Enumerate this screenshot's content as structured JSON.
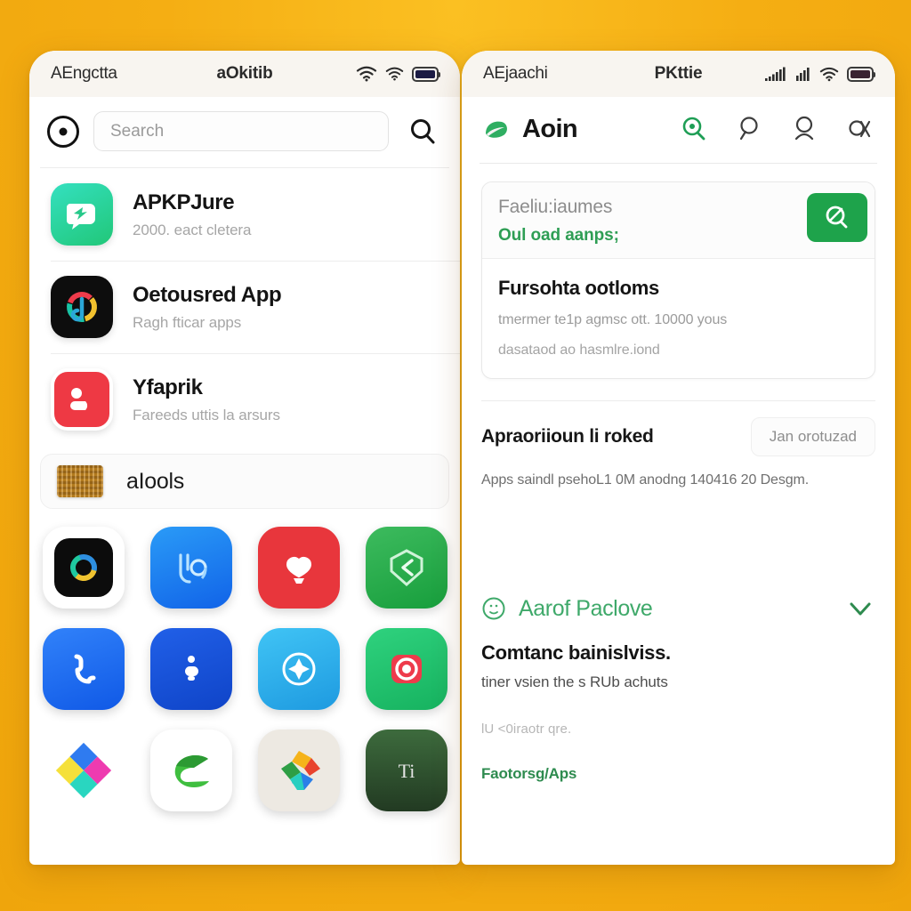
{
  "theme": {
    "background": "#F5AE13",
    "panel": "#FFFFFF",
    "statusbar": "#F8F5F0",
    "brand_green": "#1EA34B",
    "link_green": "#2E8B4F",
    "muted_text": "#A6A6A6"
  },
  "left_phone": {
    "statusbar": {
      "time": "AEngctta",
      "carrier": "aOkitib",
      "icons": [
        "wifi-icon",
        "wifi-icon",
        "battery-icon"
      ]
    },
    "search": {
      "logo_icon": "target-logo-icon",
      "placeholder": "Search",
      "submit_icon": "search-icon"
    },
    "apps": [
      {
        "name": "APKPJure",
        "subtitle": "2000. eact cletera",
        "icon": "apkpure-icon",
        "icon_color": "#2FD4A8"
      },
      {
        "name": "Oetousred App",
        "subtitle": "Ragh fticar apps",
        "icon": "discovered-app-icon",
        "icon_color": "#141414"
      },
      {
        "name": "Yfaprik",
        "subtitle": "Fareeds uttis la arsurs",
        "icon": "yfaprik-icon",
        "icon_color": "#EE3944"
      }
    ],
    "featured_row": {
      "name": "aIools",
      "icon": "gold-chip-icon"
    },
    "icon_grid": [
      {
        "name": "ring-app-icon",
        "bg": "#FFFFFF",
        "glyph": "ring"
      },
      {
        "name": "bo-app-icon",
        "bg": "#1877F2",
        "glyph": "bo"
      },
      {
        "name": "heart-app-icon",
        "bg": "#E8363C",
        "glyph": "heart"
      },
      {
        "name": "shield-app-icon",
        "bg": "#27A348",
        "glyph": "shield"
      },
      {
        "name": "phone-app-icon",
        "bg": "#1A6EF5",
        "glyph": "phone"
      },
      {
        "name": "messenger-app-icon",
        "bg": "#1456E0",
        "glyph": "messenger"
      },
      {
        "name": "compass-app-icon",
        "bg": "#2BAEF0",
        "glyph": "compass"
      },
      {
        "name": "camera-app-icon",
        "bg": "#1FBF6E",
        "glyph": "camera"
      },
      {
        "name": "diamond-app-icon",
        "bg": "#FFFFFF",
        "glyph": "diamond"
      },
      {
        "name": "e-app-icon",
        "bg": "#FFFFFF",
        "glyph": "eleaf"
      },
      {
        "name": "pinwheel-app-icon",
        "bg": "#EDE9E2",
        "glyph": "pinwheel"
      },
      {
        "name": "ti-app-icon",
        "bg": "#2E4A2E",
        "glyph": "ti"
      }
    ]
  },
  "right_phone": {
    "statusbar": {
      "time": "AEjaachi",
      "carrier": "PKttie",
      "icons": [
        "signal-icon",
        "signal-icon",
        "wifi-icon",
        "battery-icon"
      ]
    },
    "header": {
      "brand_icon": "leaf-brand-icon",
      "brand_name": "Aoin",
      "actions": [
        {
          "name": "search-active-icon"
        },
        {
          "name": "search-icon"
        },
        {
          "name": "account-icon"
        },
        {
          "name": "settings-icon"
        }
      ]
    },
    "promo_card": {
      "title": "Faeliu:iaumes",
      "subtitle": "Oul oad aanps;",
      "cta_icon": "download-search-icon",
      "body_heading": "Fursohta ootloms",
      "body_line1": "tmermer te1p agmsc ott. 10000 yous",
      "body_line2": "dasataod ao hasmlre.iond"
    },
    "section": {
      "title": "Apraoriioun li roked",
      "button_label": "Jan orotuzad",
      "note": "Apps saindl psehoL1 0M anodng 140416 20 Desgm."
    },
    "expandable": {
      "icon": "info-circle-icon",
      "label": "Aarof Paclove",
      "chevron_icon": "chevron-down-icon",
      "heading": "Comtanc bainislviss.",
      "paragraph": "tiner vsien the s RUb achuts",
      "faint_text": "lU <0iraotr qre.",
      "link": "Faotorsg/Aps"
    }
  }
}
